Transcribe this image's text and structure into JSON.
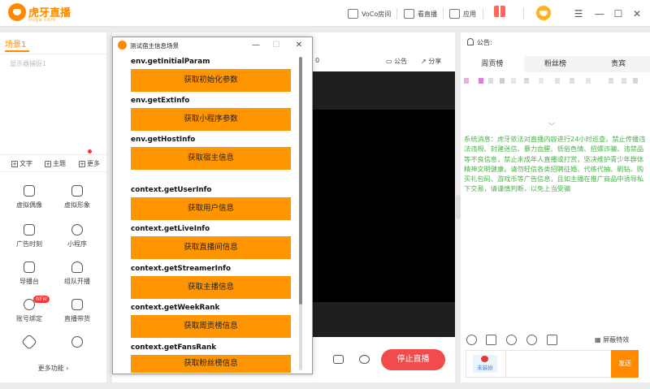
{
  "app": {
    "logo_text": "虎牙直播",
    "logo_sub": "huya.com"
  },
  "topbar": {
    "voco_label": "VoCo房间",
    "watch_label": "看直播",
    "apps_label": "应用",
    "minimize_icon": "minus",
    "maximize_icon": "square",
    "close_icon": "close"
  },
  "left": {
    "scene_tab": "场景1",
    "scene_item": "显示器捕捉1",
    "add_text": "文字",
    "add_theme": "主题",
    "add_more": "更多",
    "tools": [
      {
        "label": "虚拟偶像"
      },
      {
        "label": "虚拟形象"
      },
      {
        "label": "广告时刻"
      },
      {
        "label": "小程序"
      },
      {
        "label": "导播台"
      },
      {
        "label": "组队开播"
      },
      {
        "label": "账号绑定"
      },
      {
        "label": "直播带货"
      },
      {
        "label": ""
      },
      {
        "label": ""
      }
    ],
    "new_badge": "NEW",
    "more_functions": "更多功能 ›"
  },
  "center": {
    "count": "0",
    "notice_btn": "公告",
    "share_btn": "分享",
    "stop_live": "停止直播"
  },
  "right": {
    "notice_label": "公告:",
    "tabs": [
      "周贡榜",
      "粉丝榜",
      "贵宾"
    ],
    "chevron": "﹀",
    "system_message": "系统消息：虎牙依法对直播内容进行24小时巡查，禁止传播违法违规、封建迷信、暴力血腥、低俗色情、招嫖诈骗、违禁品等不良信息，禁止未成年人直播或打赏，坚决维护青少年群体精神文明健康。请勿轻信各类招聘征婚、代练代抽、刷钻、购买礼包码、游戏币等广告信息，且如主播在推广商品中诱导私下交易，请谨慎判断，以免上当受骗",
    "shield_effects": "屏蔽特效",
    "fan_badge": "未装扮",
    "send": "发送"
  },
  "dialog": {
    "title": "测试宿主信息场景",
    "items": [
      {
        "api": "env.getInitialParam",
        "button": "获取初始化参数"
      },
      {
        "api": "env.getExtInfo",
        "button": "获取小程序参数"
      },
      {
        "api": "env.getHostInfo",
        "button": "获取宿主信息"
      },
      {
        "api": "context.getUserInfo",
        "button": "获取用户信息"
      },
      {
        "api": "context.getLiveInfo",
        "button": "获取直播间信息"
      },
      {
        "api": "context.getStreamerInfo",
        "button": "获取主播信息"
      },
      {
        "api": "context.getWeekRank",
        "button": "获取周贡榜信息"
      },
      {
        "api": "context.getFansRank",
        "button": "获取粉丝榜信息"
      }
    ]
  },
  "colors": {
    "accent": "#ff8a00",
    "dialog_button": "#ff9500",
    "stop_button": "#f24b4b",
    "system_message": "#49b449"
  }
}
